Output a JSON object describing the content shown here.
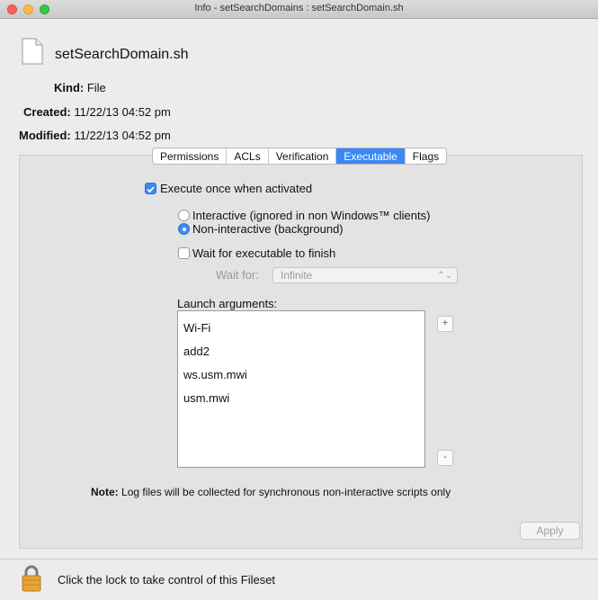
{
  "window": {
    "title": "Info - setSearchDomains : setSearchDomain.sh"
  },
  "file": {
    "name": "setSearchDomain.sh",
    "kind_label": "Kind:",
    "kind_value": "File",
    "created_label": "Created:",
    "created_value": "11/22/13 04:52 pm",
    "modified_label": "Modified:",
    "modified_value": "11/22/13 04:52 pm"
  },
  "tabs": [
    {
      "label": "Permissions",
      "active": false
    },
    {
      "label": "ACLs",
      "active": false
    },
    {
      "label": "Verification",
      "active": false
    },
    {
      "label": "Executable",
      "active": true
    },
    {
      "label": "Flags",
      "active": false
    }
  ],
  "executable": {
    "execute_once_label": "Execute once when activated",
    "execute_once_checked": true,
    "interactive_label": "Interactive (ignored in non Windows™ clients)",
    "non_interactive_label": "Non-interactive (background)",
    "selected_mode": "non-interactive",
    "wait_label": "Wait for executable to finish",
    "wait_checked": false,
    "wait_for_label": "Wait for:",
    "wait_for_value": "Infinite",
    "launch_args_label": "Launch arguments:",
    "launch_args": [
      "Wi-Fi",
      "add2",
      "ws.usm.mwi",
      "usm.mwi"
    ],
    "add_label": "+",
    "remove_label": "-",
    "note_label": "Note:",
    "note_text": "Log files will be collected for synchronous non-interactive scripts only",
    "apply_label": "Apply"
  },
  "footer": {
    "lock_text": "Click the lock to take control of this Fileset"
  },
  "colors": {
    "accent": "#3b88f5",
    "lock": "#e8a23a"
  }
}
